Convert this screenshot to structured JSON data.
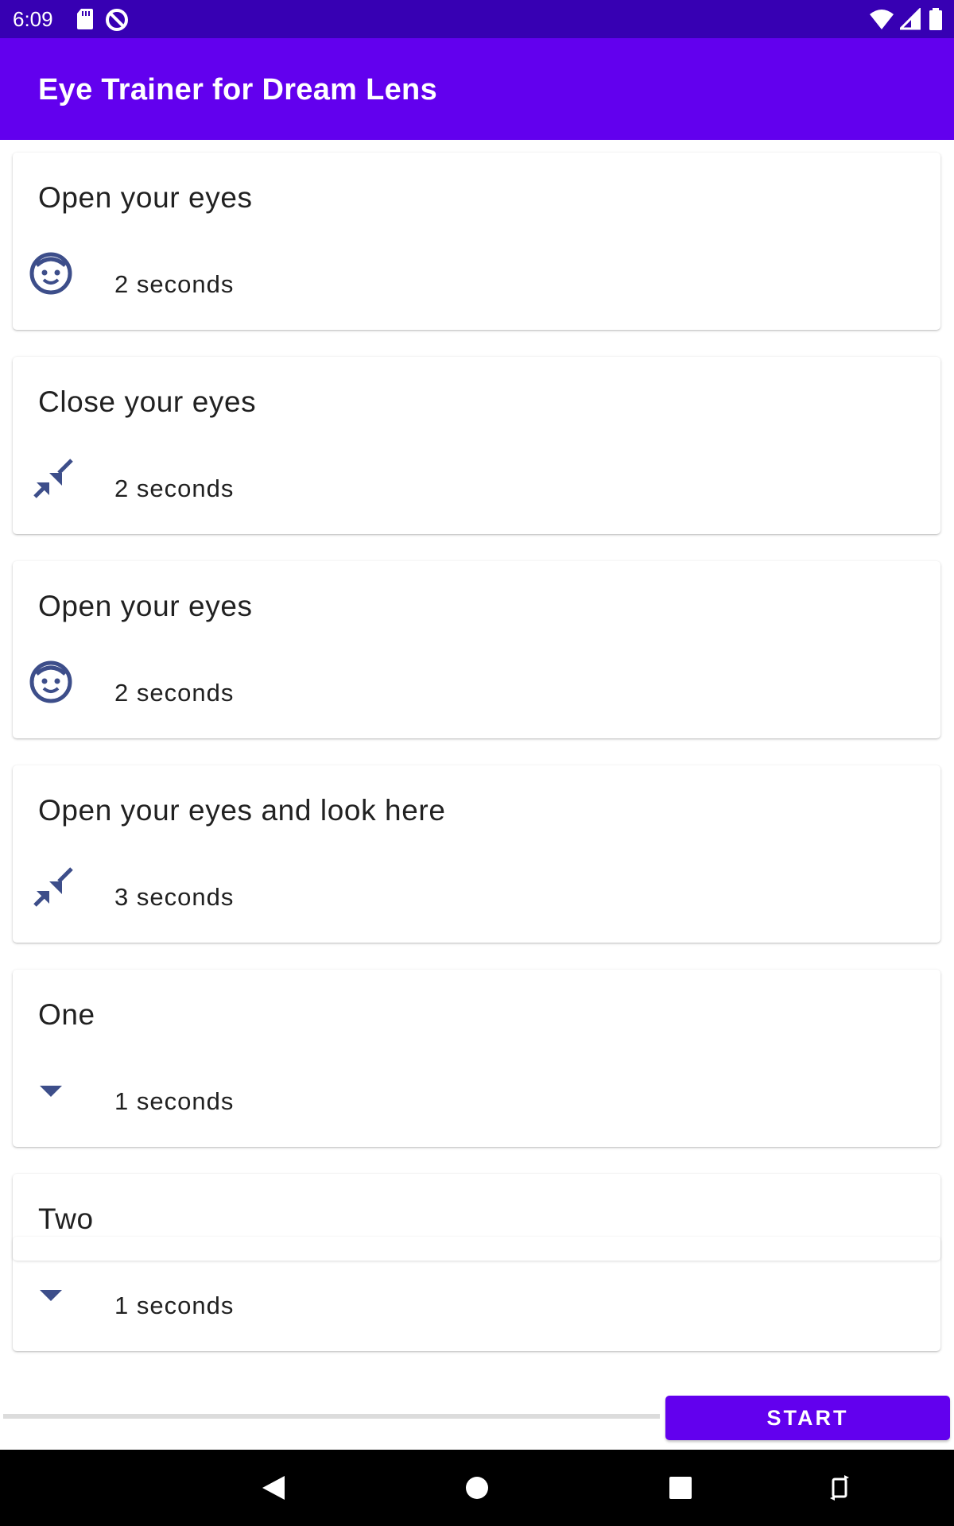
{
  "status_bar": {
    "time": "6:09",
    "left_icons": [
      "sd-card-icon",
      "do-not-disturb-icon"
    ],
    "right_icons": [
      "wifi-icon",
      "signal-icon",
      "battery-icon"
    ]
  },
  "app_bar": {
    "title": "Eye Trainer for Dream Lens",
    "background": "#6200ee",
    "status_background": "#3700b3"
  },
  "steps": [
    {
      "title": "Open your eyes",
      "duration": "2 seconds",
      "icon": "face-icon"
    },
    {
      "title": "Close your eyes",
      "duration": "2 seconds",
      "icon": "collapse-arrows-icon"
    },
    {
      "title": "Open your eyes",
      "duration": "2 seconds",
      "icon": "face-icon"
    },
    {
      "title": "Open your eyes and look here",
      "duration": "3 seconds",
      "icon": "collapse-arrows-icon"
    },
    {
      "title": "One",
      "duration": "1 seconds",
      "icon": "arrow-drop-down-icon"
    },
    {
      "title": "Two",
      "duration": "1 seconds",
      "icon": "arrow-drop-down-icon"
    }
  ],
  "footer": {
    "start_label": "START",
    "progress": 0,
    "accent": "#6200ee",
    "icon_color": "#3d4e8a"
  },
  "nav_bar": {
    "buttons": [
      "back-icon",
      "home-icon",
      "recents-icon",
      "rotate-icon"
    ]
  }
}
